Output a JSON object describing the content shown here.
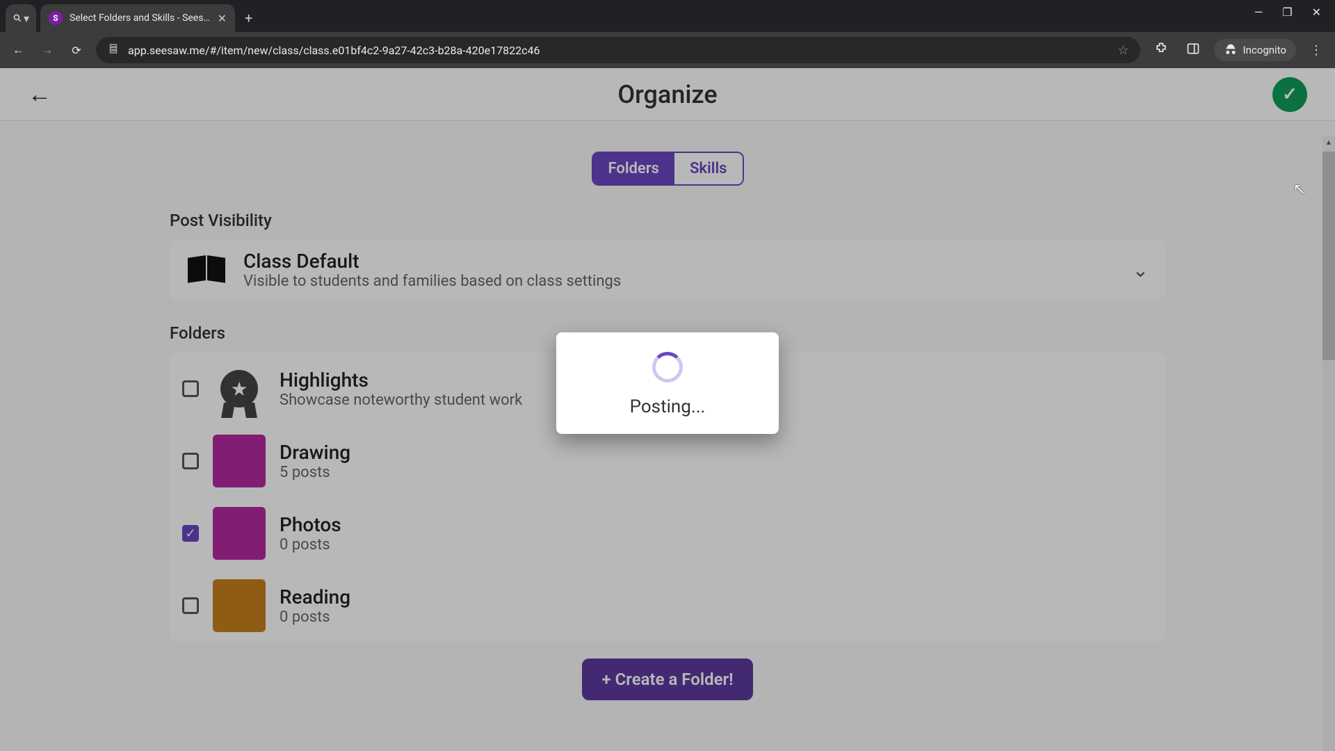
{
  "browser": {
    "tab_title": "Select Folders and Skills - Sees…",
    "favicon_letter": "S",
    "url_display": "app.seesaw.me/#/item/new/class/class.e01bf4c2-9a27-42c3-b28a-420e17822c46",
    "incognito_label": "Incognito"
  },
  "header": {
    "title": "Organize"
  },
  "tabs": {
    "folders": "Folders",
    "skills": "Skills",
    "active": "folders"
  },
  "sections": {
    "visibility_label": "Post Visibility",
    "folders_label": "Folders"
  },
  "visibility": {
    "title": "Class Default",
    "subtitle": "Visible to students and families based on class settings"
  },
  "folders": [
    {
      "name": "Highlights",
      "sub": "Showcase noteworthy student work",
      "checked": false,
      "icon": "badge",
      "color": ""
    },
    {
      "name": "Drawing",
      "sub": "5 posts",
      "checked": false,
      "icon": "color",
      "color": "#b329a0"
    },
    {
      "name": "Photos",
      "sub": "0 posts",
      "checked": true,
      "icon": "color",
      "color": "#b329a0"
    },
    {
      "name": "Reading",
      "sub": "0 posts",
      "checked": false,
      "icon": "color",
      "color": "#c6801e"
    }
  ],
  "create_button": "+ Create a Folder!",
  "modal": {
    "text": "Posting..."
  }
}
